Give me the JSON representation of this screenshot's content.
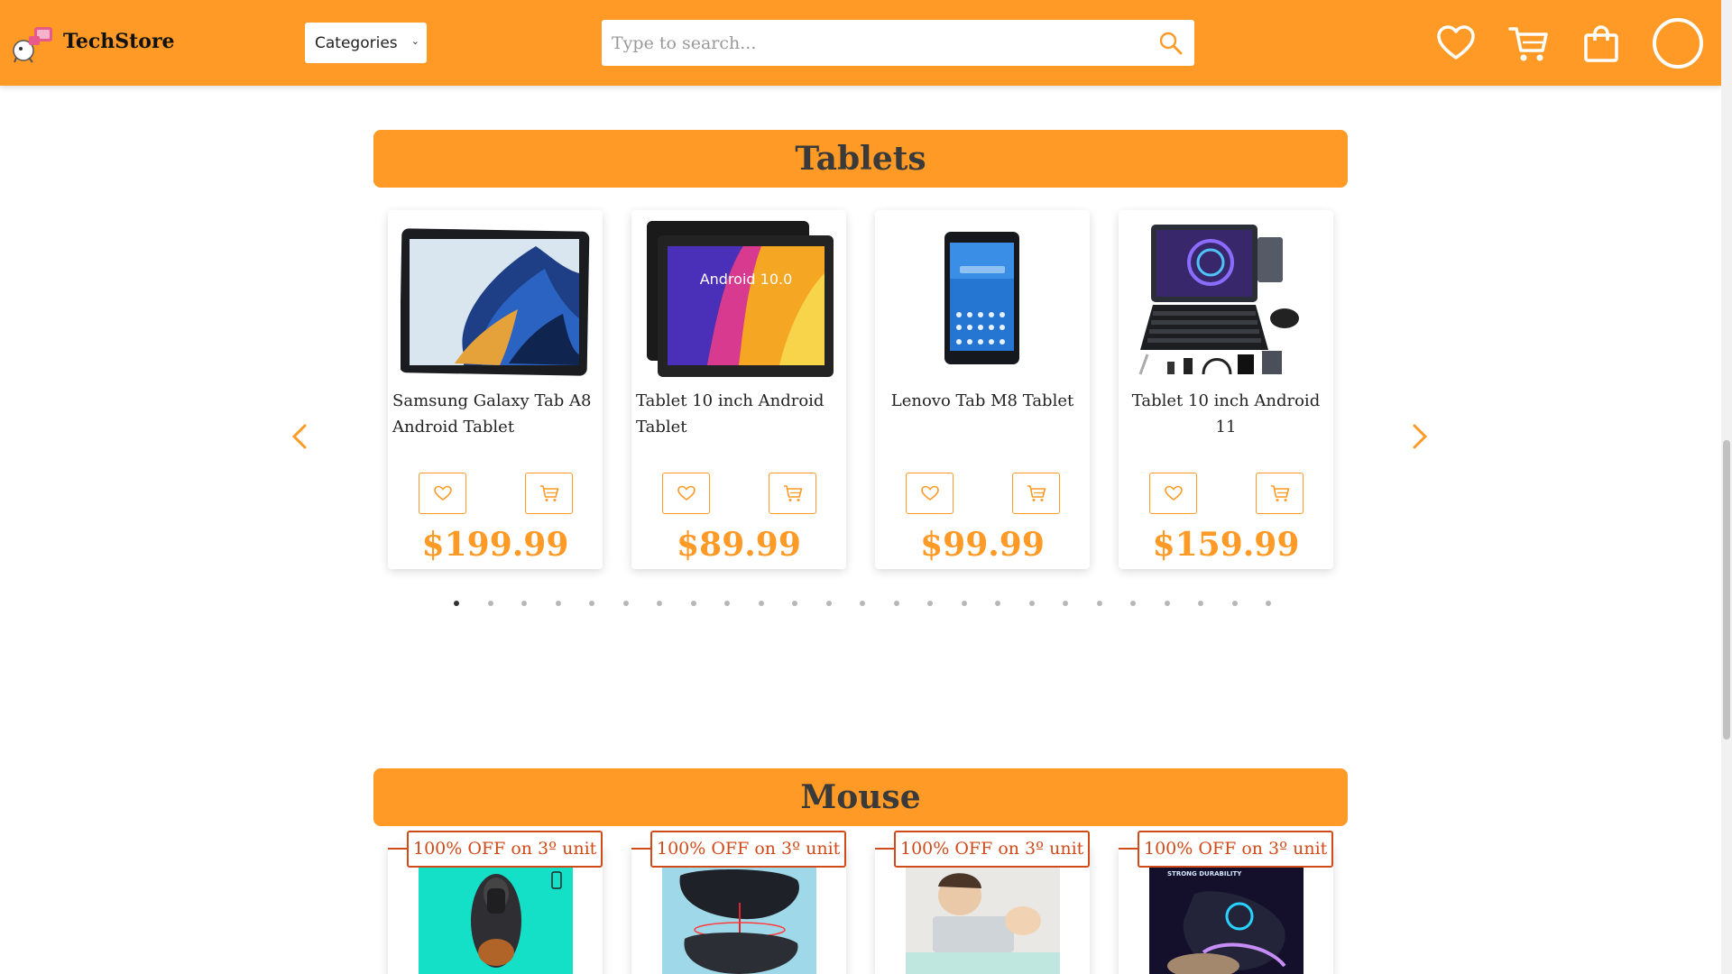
{
  "header": {
    "brand": "TechStore",
    "categories_label": "Categories",
    "categories_caret": "⌄",
    "search_placeholder": "Type to search..."
  },
  "sections": {
    "tablets": {
      "title": "Tablets",
      "products": [
        {
          "name": "Samsung Galaxy Tab A8 Android Tablet",
          "price": "$199.99"
        },
        {
          "name": "Tablet 10 inch Android Tablet",
          "price": "$89.99",
          "screen_text": "Android 10.0"
        },
        {
          "name": "Lenovo Tab M8 Tablet",
          "price": "$99.99"
        },
        {
          "name": "Tablet 10 inch Android 11",
          "price": "$159.99"
        }
      ],
      "carousel": {
        "total_dots": 25,
        "active_index": 0
      }
    },
    "mouse": {
      "title": "Mouse",
      "products": [
        {
          "promo": "100% OFF on 3º unit"
        },
        {
          "promo": "100% OFF on 3º unit"
        },
        {
          "promo": "100% OFF on 3º unit"
        },
        {
          "promo": "100% OFF on 3º unit",
          "image_text": "STRONG DURABILITY"
        }
      ]
    }
  },
  "colors": {
    "accent": "#fe9a25",
    "promo": "#d14b1a",
    "text": "#222222"
  },
  "icons": [
    "heart-icon",
    "cart-icon",
    "shopping-bag-icon",
    "search-icon",
    "chevron-left-icon",
    "chevron-right-icon"
  ]
}
